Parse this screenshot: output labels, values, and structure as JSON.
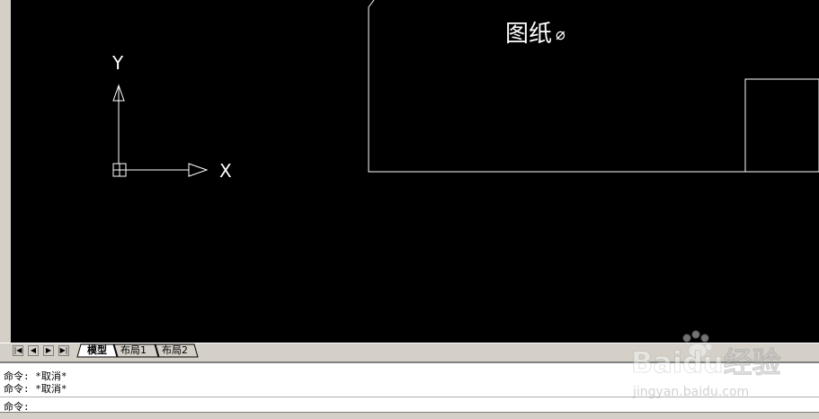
{
  "drawing": {
    "title_text": "图纸",
    "title_symbol": "⌀",
    "ucs": {
      "x_label": "X",
      "y_label": "Y"
    }
  },
  "tabs": {
    "nav": [
      "|◀",
      "◀",
      "▶",
      "▶|"
    ],
    "model": "模型",
    "layout1": "布局1",
    "layout2": "布局2"
  },
  "command": {
    "lines": [
      "命令: *取消*",
      "命令: *取消*"
    ],
    "prompt": "命令:"
  },
  "watermark": {
    "brand": "Baidu经验",
    "url": "jingyan.baidu.com"
  },
  "colors": {
    "canvas_bg": "#000000",
    "lines": "#ffffff",
    "chrome": "#d4d0c8"
  }
}
